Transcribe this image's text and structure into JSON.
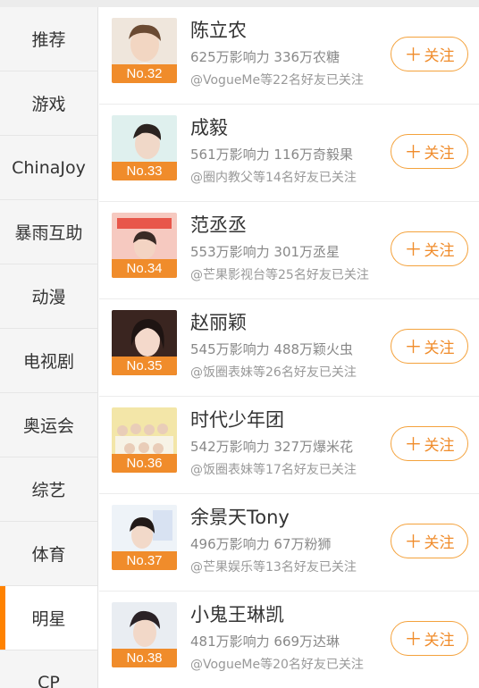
{
  "sidebar": {
    "items": [
      {
        "label": "推荐",
        "active": false
      },
      {
        "label": "游戏",
        "active": false
      },
      {
        "label": "ChinaJoy",
        "active": false
      },
      {
        "label": "暴雨互助",
        "active": false
      },
      {
        "label": "动漫",
        "active": false
      },
      {
        "label": "电视剧",
        "active": false
      },
      {
        "label": "奥运会",
        "active": false
      },
      {
        "label": "综艺",
        "active": false
      },
      {
        "label": "体育",
        "active": false
      },
      {
        "label": "明星",
        "active": true
      },
      {
        "label": "CP",
        "active": false
      }
    ]
  },
  "follow_button": {
    "plus": "＋",
    "label": "关注"
  },
  "colors": {
    "accent": "#f08c2b",
    "active_bar": "#ff8200"
  },
  "list": {
    "rows": [
      {
        "rank": "No.32",
        "name": "陈立农",
        "stats": "625万影响力 336万农糖",
        "friends": "@VogueMe等22名好友已关注"
      },
      {
        "rank": "No.33",
        "name": "成毅",
        "stats": "561万影响力 116万奇毅果",
        "friends": "@圈内教父等14名好友已关注"
      },
      {
        "rank": "No.34",
        "name": "范丞丞",
        "stats": "553万影响力 301万丞星",
        "friends": "@芒果影视台等25名好友已关注"
      },
      {
        "rank": "No.35",
        "name": "赵丽颖",
        "stats": "545万影响力 488万颖火虫",
        "friends": "@饭圈表妹等26名好友已关注"
      },
      {
        "rank": "No.36",
        "name": "时代少年团",
        "stats": "542万影响力 327万爆米花",
        "friends": "@饭圈表妹等17名好友已关注"
      },
      {
        "rank": "No.37",
        "name": "余景天Tony",
        "stats": "496万影响力 67万粉狮",
        "friends": "@芒果娱乐等13名好友已关注"
      },
      {
        "rank": "No.38",
        "name": "小鬼王琳凯",
        "stats": "481万影响力 669万达琳",
        "friends": "@VogueMe等20名好友已关注"
      }
    ]
  }
}
